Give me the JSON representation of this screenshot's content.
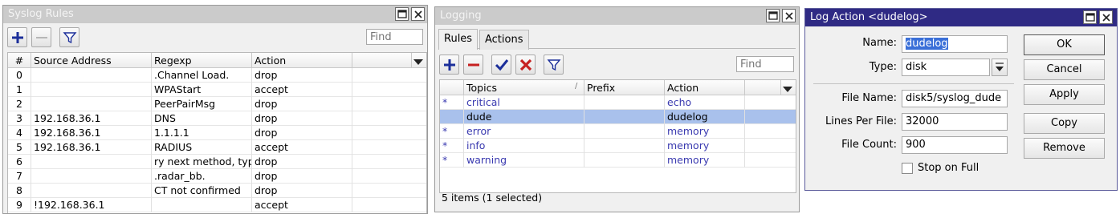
{
  "syslog": {
    "title": "Syslog Rules",
    "find_placeholder": "Find",
    "columns": [
      "#",
      "Source Address",
      "Regexp",
      "Action"
    ],
    "rows": [
      {
        "num": "0",
        "src": "",
        "regexp": ".Channel Load.",
        "action": "drop"
      },
      {
        "num": "1",
        "src": "",
        "regexp": "WPAStart",
        "action": "accept"
      },
      {
        "num": "2",
        "src": "",
        "regexp": "PeerPairMsg",
        "action": "drop"
      },
      {
        "num": "3",
        "src": "192.168.36.1",
        "regexp": "DNS",
        "action": "drop"
      },
      {
        "num": "4",
        "src": "192.168.36.1",
        "regexp": "1.1.1.1",
        "action": "drop"
      },
      {
        "num": "5",
        "src": "192.168.36.1",
        "regexp": "RADIUS",
        "action": "accept"
      },
      {
        "num": "6",
        "src": "",
        "regexp": "ry next method, typ...",
        "action": "drop"
      },
      {
        "num": "7",
        "src": "",
        "regexp": ".radar_bb.",
        "action": "drop"
      },
      {
        "num": "8",
        "src": "",
        "regexp": "CT not confirmed",
        "action": "drop"
      },
      {
        "num": "9",
        "src": "!192.168.36.1",
        "regexp": "",
        "action": "accept"
      }
    ]
  },
  "logging": {
    "title": "Logging",
    "tabs": [
      "Rules",
      "Actions"
    ],
    "find_placeholder": "Find",
    "columns": [
      "Topics",
      "Prefix",
      "Action"
    ],
    "rows": [
      {
        "mark": "*",
        "topics": "critical",
        "prefix": "",
        "action": "echo",
        "selected": false
      },
      {
        "mark": "",
        "topics": "dude",
        "prefix": "",
        "action": "dudelog",
        "selected": true
      },
      {
        "mark": "*",
        "topics": "error",
        "prefix": "",
        "action": "memory",
        "selected": false
      },
      {
        "mark": "*",
        "topics": "info",
        "prefix": "",
        "action": "memory",
        "selected": false
      },
      {
        "mark": "*",
        "topics": "warning",
        "prefix": "",
        "action": "memory",
        "selected": false
      }
    ],
    "status": "5 items (1 selected)"
  },
  "log_action": {
    "title": "Log Action <dudelog>",
    "fields": {
      "name_label": "Name:",
      "name_value": "dudelog",
      "type_label": "Type:",
      "type_value": "disk",
      "file_name_label": "File Name:",
      "file_name_value": "disk5/syslog_dude",
      "lines_label": "Lines Per File:",
      "lines_value": "32000",
      "count_label": "File Count:",
      "count_value": "900",
      "stop_label": "Stop on Full"
    },
    "stop_on_full": false,
    "buttons": {
      "ok": "OK",
      "cancel": "Cancel",
      "apply": "Apply",
      "copy": "Copy",
      "remove": "Remove"
    }
  },
  "colors": {
    "accent_blue": "#2f2a84",
    "topic_blue": "#3a3ab0",
    "selected_row": "#a9c1ec"
  }
}
